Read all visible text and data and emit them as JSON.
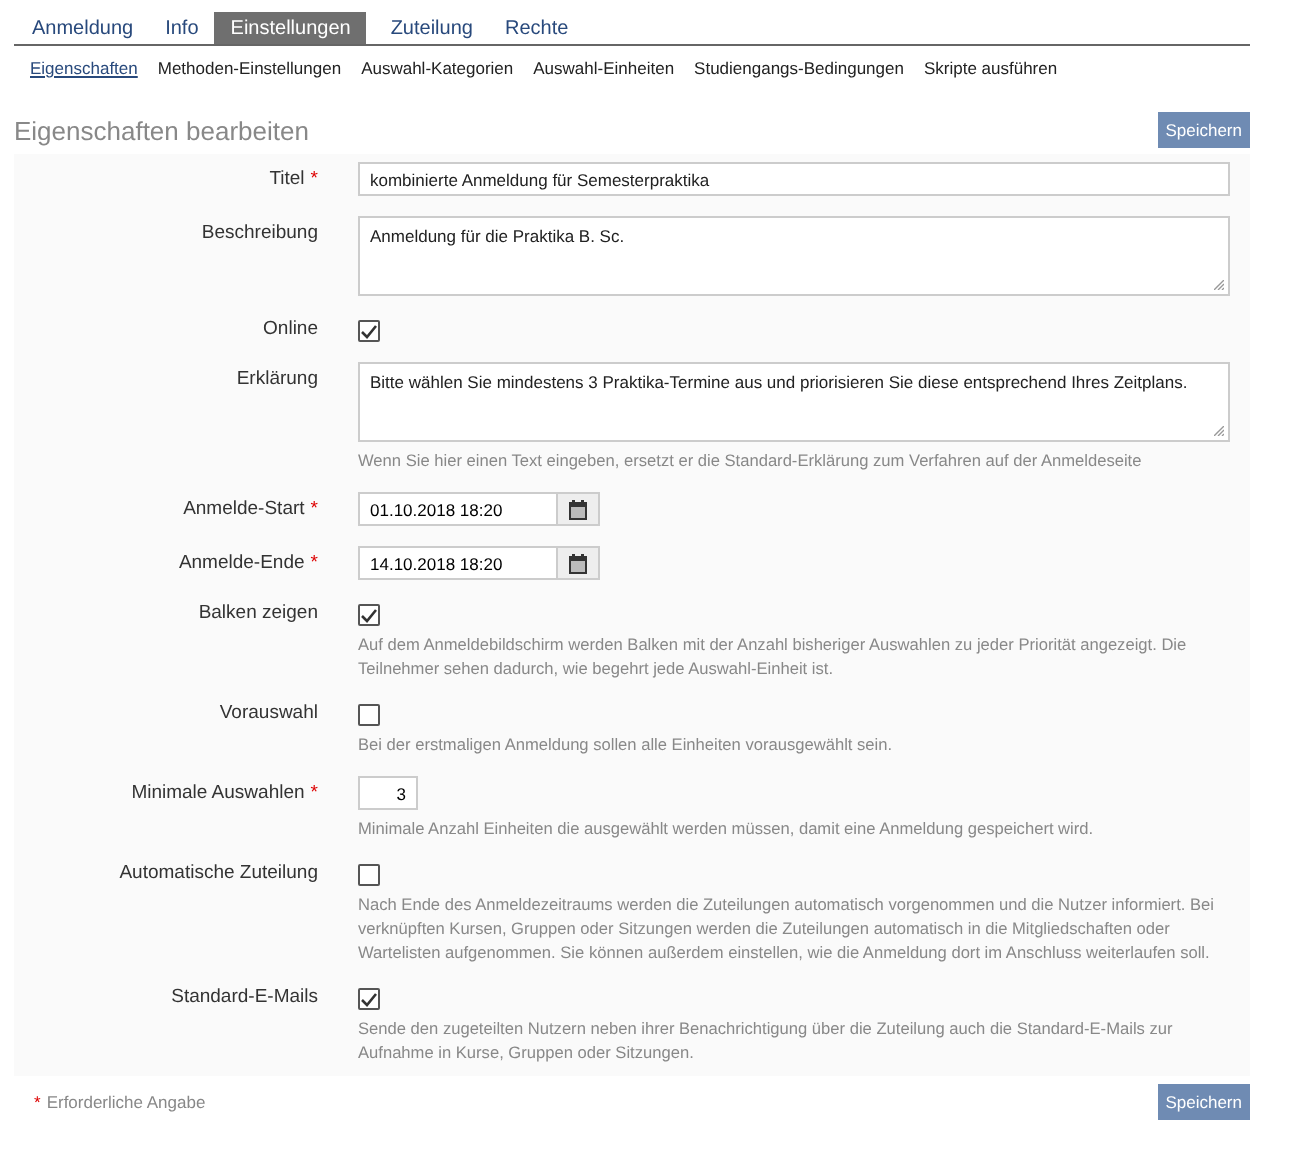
{
  "tabs": [
    {
      "label": "Anmeldung",
      "selected": false
    },
    {
      "label": "Info",
      "selected": false
    },
    {
      "label": "Einstellungen",
      "selected": true
    },
    {
      "label": "Zuteilung",
      "selected": false
    },
    {
      "label": "Rechte",
      "selected": false
    }
  ],
  "subnav": [
    {
      "label": "Eigenschaften",
      "selected": true
    },
    {
      "label": "Methoden-Einstellungen",
      "selected": false
    },
    {
      "label": "Auswahl-Kategorien",
      "selected": false
    },
    {
      "label": "Auswahl-Einheiten",
      "selected": false
    },
    {
      "label": "Studiengangs-Bedingungen",
      "selected": false
    },
    {
      "label": "Skripte ausführen",
      "selected": false
    }
  ],
  "heading": "Eigenschaften bearbeiten",
  "save_label": "Speichern",
  "footer_save_label": "Speichern",
  "fields": [
    {
      "kind": "text",
      "label": "Titel",
      "required": true,
      "value": "kombinierte Anmeldung für Semesterpraktika"
    },
    {
      "kind": "textarea",
      "label": "Beschreibung",
      "required": false,
      "value": "Anmeldung für die Praktika B. Sc."
    },
    {
      "kind": "checkbox",
      "label": "Online",
      "required": false,
      "checked": true
    },
    {
      "kind": "textarea",
      "label": "Erklärung",
      "required": false,
      "value": "Bitte wählen Sie mindestens 3 Praktika-Termine aus und priorisieren Sie diese entsprechend Ihres Zeitplans.",
      "hint": "Wenn Sie hier einen Text eingeben, ersetzt er die Standard-Erklärung zum Verfahren auf der Anmeldeseite"
    },
    {
      "kind": "date",
      "label": "Anmelde-Start",
      "required": true,
      "value": "01.10.2018 18:20"
    },
    {
      "kind": "date",
      "label": "Anmelde-Ende",
      "required": true,
      "value": "14.10.2018 18:20"
    },
    {
      "kind": "checkbox",
      "label": "Balken zeigen",
      "required": false,
      "checked": true,
      "hint": "Auf dem Anmeldebildschirm werden Balken mit der Anzahl bisheriger Auswahlen zu jeder Priorität angezeigt. Die Teilnehmer sehen dadurch, wie begehrt jede Auswahl-Einheit ist."
    },
    {
      "kind": "checkbox",
      "label": "Vorauswahl",
      "required": false,
      "checked": false,
      "hint": "Bei der erstmaligen Anmeldung sollen alle Einheiten vorausgewählt sein."
    },
    {
      "kind": "number",
      "label": "Minimale Auswahlen",
      "required": true,
      "value": "3",
      "hint": "Minimale Anzahl Einheiten die ausgewählt werden müssen, damit eine Anmeldung gespeichert wird."
    },
    {
      "kind": "checkbox",
      "label": "Automatische Zuteilung",
      "required": false,
      "checked": false,
      "hint": "Nach Ende des Anmeldezeitraums werden die Zuteilungen automatisch vorgenommen und die Nutzer informiert. Bei verknüpften Kursen, Gruppen oder Sitzungen werden die Zuteilungen automatisch in die Mitgliedschaften oder Wartelisten aufgenommen. Sie können außerdem einstellen, wie die Anmeldung dort im Anschluss weiterlaufen soll."
    },
    {
      "kind": "checkbox",
      "label": "Standard-E-Mails",
      "required": false,
      "checked": true,
      "hint": "Sende den zugeteilten Nutzern neben ihrer Benachrichtigung über die Zuteilung auch die Standard-E-Mails zur Aufnahme in Kurse, Gruppen oder Sitzungen."
    }
  ],
  "required_mark": "*",
  "required_note": "Erforderliche Angabe"
}
